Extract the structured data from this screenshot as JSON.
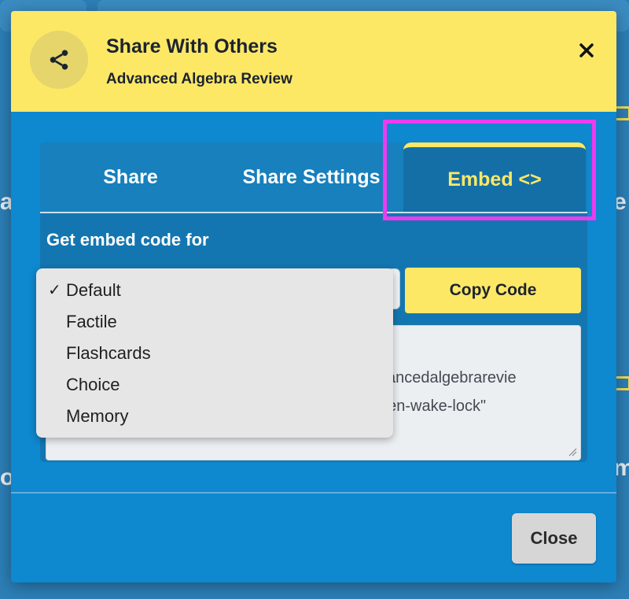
{
  "modal": {
    "title": "Share With Others",
    "subtitle": "Advanced Algebra Review",
    "close_icon": "close-icon",
    "share_icon": "share-icon"
  },
  "tabs": [
    {
      "label": "Share",
      "active": false
    },
    {
      "label": "Share Settings",
      "active": false
    },
    {
      "label": "Embed <>",
      "active": true
    }
  ],
  "embed": {
    "label": "Get embed code for",
    "copy_button": "Copy Code",
    "code_line_1": "vancedalgebrarevie",
    "code_line_2": "een-wake-lock\""
  },
  "dropdown": {
    "selected": "Default",
    "options": [
      "Default",
      "Factile",
      "Flashcards",
      "Choice",
      "Memory"
    ],
    "check_mark": "✓"
  },
  "footer": {
    "close_button": "Close"
  },
  "colors": {
    "header": "#fde866",
    "modal_bg": "#0e88cf",
    "highlight": "#ec3cf0",
    "active_tab_text": "#fde866"
  }
}
